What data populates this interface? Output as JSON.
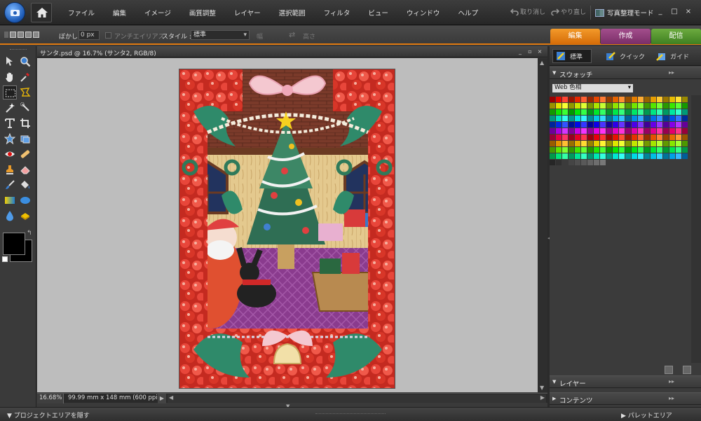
{
  "menubar": {
    "items": [
      "ファイル",
      "編集",
      "イメージ",
      "画質調整",
      "レイヤー",
      "選択範囲",
      "フィルタ",
      "ビュー",
      "ウィンドウ",
      "ヘルプ"
    ],
    "undo_label": "取り消し",
    "redo_label": "やり直し",
    "organizer_label": "写真整理モード",
    "win_min": "_",
    "win_max": "□",
    "win_close": "×"
  },
  "options": {
    "feather_label": "ぼかし :",
    "feather_value": "0 px",
    "antialias_label": "アンチエイリアス",
    "style_label": "スタイル :",
    "style_value": "標準",
    "width_label": "幅",
    "height_label": "高さ"
  },
  "mode_tabs": {
    "edit": "編集",
    "create": "作成",
    "share": "配信",
    "colors": {
      "edit": "#e8830f",
      "create": "#8e3c7a",
      "share": "#54952f"
    }
  },
  "document": {
    "title": "サンタ.psd @ 16.7% (サンタ2, RGB/8)",
    "zoom": "16.68%",
    "size_info": "99.99 mm x 148 mm (600 ppi)"
  },
  "right_panel": {
    "modes": {
      "full": "標準",
      "quick": "クイック",
      "guide": "ガイド"
    },
    "swatches_title": "スウォッチ",
    "swatch_set": "Web 色相",
    "layers_title": "レイヤー",
    "contents_title": "コンテンツ"
  },
  "bottom_bar": {
    "project_toggle": "プロジェクトエリアを隠す",
    "palette_toggle": "パレットエリア"
  },
  "colors": {
    "accent": "#e07a10",
    "foreground": "#000000",
    "background": "#000000",
    "canvas_bg": "#bdbdbd"
  }
}
